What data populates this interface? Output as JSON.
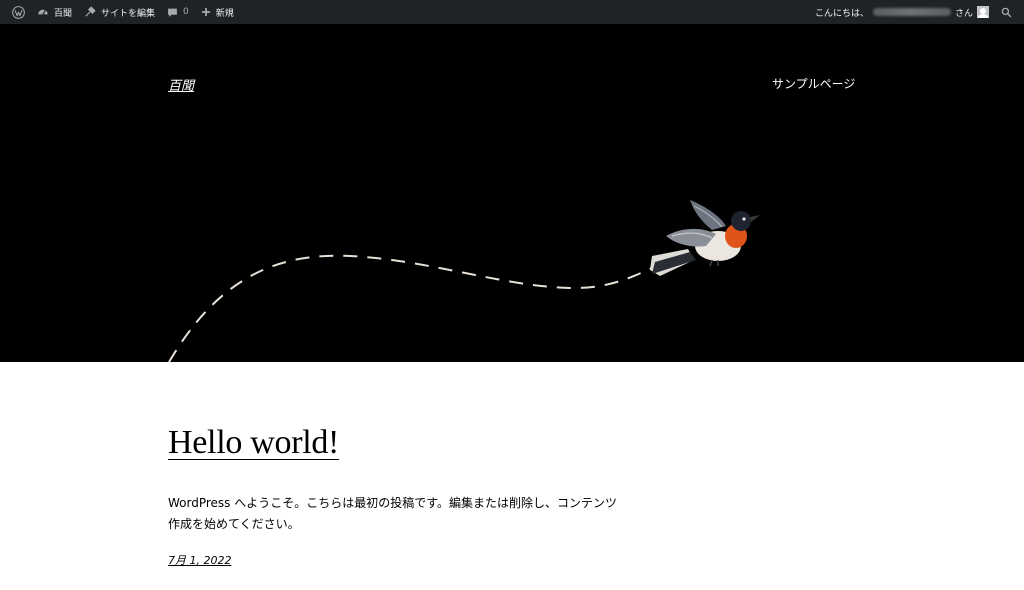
{
  "admin_bar": {
    "site_name": "百聞",
    "customize_label": "サイトを編集",
    "comments_count": "0",
    "new_label": "新規",
    "greeting": "こんにちは、",
    "greeting_suffix": "さん",
    "colors": {
      "background": "#1d2327",
      "text": "#f0f0f1"
    }
  },
  "header": {
    "site_title": "百聞",
    "nav": [
      {
        "label": "サンプルページ"
      }
    ],
    "colors": {
      "background": "#000000",
      "text": "#ffffff",
      "bird_breast": "#e0541a"
    }
  },
  "post": {
    "title": "Hello world!",
    "body": "WordPress へようこそ。こちらは最初の投稿です。編集または削除し、コンテンツ作成を始めてください。",
    "date": "7月 1, 2022"
  },
  "icons": [
    "wordpress-icon",
    "dashboard-icon",
    "edit-site-icon",
    "comment-icon",
    "plus-icon",
    "search-icon"
  ]
}
